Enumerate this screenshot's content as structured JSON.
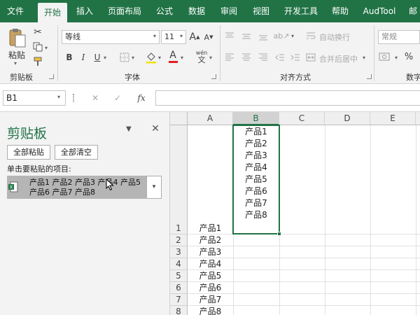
{
  "ribbon_tabs": [
    {
      "label": "文件"
    },
    {
      "label": "开始"
    },
    {
      "label": "插入"
    },
    {
      "label": "页面布局"
    },
    {
      "label": "公式"
    },
    {
      "label": "数据"
    },
    {
      "label": "审阅"
    },
    {
      "label": "视图"
    },
    {
      "label": "开发工具"
    },
    {
      "label": "帮助"
    },
    {
      "label": "AudTool"
    },
    {
      "label": "邮"
    }
  ],
  "clipboard_group": {
    "paste_label": "粘贴",
    "group_label": "剪贴板"
  },
  "font_group": {
    "font_name": "等线",
    "font_size": "11",
    "grow_label": "A",
    "shrink_label": "A",
    "bold": "B",
    "italic": "I",
    "underline": "U",
    "font_color_label": "A",
    "phonetic_label": "wén",
    "group_label": "字体"
  },
  "alignment_group": {
    "wrap_text": "自动换行",
    "merge_center": "合并后居中",
    "group_label": "对齐方式"
  },
  "number_group": {
    "format": "常规",
    "percent": "%",
    "group_label": "数字"
  },
  "colors": {
    "excel_green": "#217346",
    "font_red": "#e02020",
    "pane_item_bg": "#b5b5b5"
  },
  "formula_bar": {
    "name_box": "B1",
    "cancel": "✕",
    "enter": "✓",
    "fx": "fx",
    "value": ""
  },
  "clipboard_pane": {
    "title": "剪贴板",
    "paste_all": "全部粘贴",
    "clear_all": "全部清空",
    "instruction": "单击要粘贴的项目:",
    "item_line1": "产品1 产品2 产品3 产品4 产品5",
    "item_line2": "产品6 产品7 产品8"
  },
  "sheet": {
    "columns": [
      "A",
      "B",
      "C",
      "D",
      "E"
    ],
    "selected_column": "B",
    "rows": [
      "1",
      "2",
      "3",
      "4",
      "5",
      "6",
      "7",
      "8"
    ],
    "column_a": [
      "产品1",
      "产品2",
      "产品3",
      "产品4",
      "产品5",
      "产品6",
      "产品7",
      "产品8"
    ],
    "cell_b1_lines": [
      "产品1",
      "产品2",
      "产品3",
      "产品4",
      "产品5",
      "产品6",
      "产品7",
      "产品8"
    ]
  }
}
